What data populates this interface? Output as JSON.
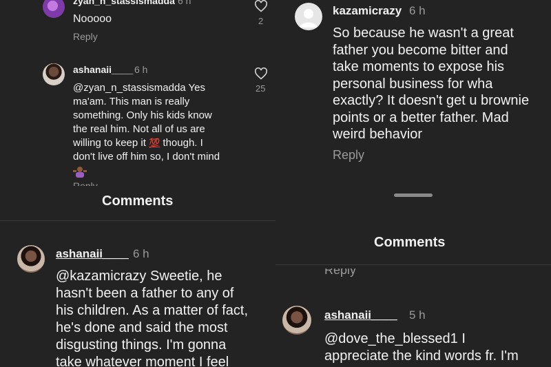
{
  "panel1": {
    "comment1": {
      "username": "zyan_n_stassismadda",
      "time": "6 h",
      "text": "Nooooo",
      "reply": "Reply",
      "likes": "2"
    },
    "comment2": {
      "username": "ashanaii____",
      "time": "6 h",
      "lines": [
        "@zyan_n_stassismadda Yes",
        "ma'am. This man is really",
        "something. Only his kids know",
        "the real him. Not all of us are",
        "willing to keep it",
        "though. I",
        "don't live off him so, I don't mind"
      ],
      "likes": "25",
      "reply_partial": "Reply"
    }
  },
  "panel2": {
    "header_title": "Comments",
    "comment": {
      "username": "ashanaii____",
      "time": "6 h",
      "lines": [
        "@kazamicrazy Sweetie, he",
        "hasn't been a father to any of",
        "his children. As a matter of fact,",
        "he's done and said the most",
        "disgusting things. I'm gonna",
        "take whatever moment I feel"
      ]
    }
  },
  "panel3": {
    "comment": {
      "username": "kazamicrazy",
      "time": "6 h",
      "lines": [
        "So because he wasn't a great",
        "father you become bitter and",
        "take moments to expose his",
        "personal business for wha",
        "exactly? It doesn't get u brownie",
        "points or a better father. Mad",
        "weird behavior"
      ],
      "reply": "Reply"
    },
    "header_title": "Comments"
  },
  "panel4": {
    "reply_above": "Reply",
    "comment": {
      "username": "ashanaii____",
      "time": "5 h",
      "lines": [
        "@dove_the_blessed1 I",
        "appreciate the kind words fr. I'm"
      ]
    }
  },
  "colors": {
    "background": "#232323",
    "muted": "#9a9a9a",
    "text": "#f2f2f2"
  },
  "icons": [
    "heart-icon",
    "hundred-points-emoji",
    "shrug-emoji",
    "sheet-handle"
  ]
}
